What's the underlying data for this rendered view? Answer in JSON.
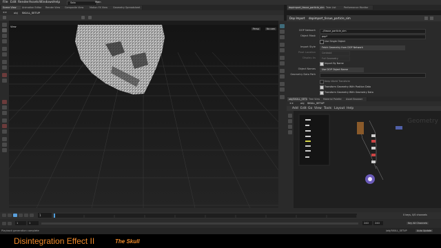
{
  "menu": [
    "File",
    "Edit",
    "Render",
    "Assets",
    "Windows",
    "Help"
  ],
  "menu_extras": {
    "desktop": "Solo",
    "main": "Main"
  },
  "left_tabs": [
    "Scene View",
    "Animation Editor",
    "Render View",
    "Composite View",
    "Motion FX View",
    "Geometry Spreadsheet"
  ],
  "right_tabs": [
    "dopimport_tissue_particle_sim",
    "Take List",
    "Performance Monitor"
  ],
  "viewport": {
    "path_obj": "obj",
    "path_node": "SKULL_SETUP",
    "title": "View",
    "persp": "Persp",
    "cam": "No cam"
  },
  "params": {
    "node_type": "Dop Import",
    "node_name": "dopimport_tissue_particle_sim",
    "rows": [
      {
        "label": "DOP Network",
        "value": "../tissue_particle_sim",
        "kind": "field"
      },
      {
        "label": "Object Mask",
        "value": "pop*",
        "kind": "field"
      },
      {
        "label": "",
        "value": "Use Single Object",
        "kind": "check"
      },
      {
        "label": "Import Style",
        "value": "Fetch Geometry from DOP Network",
        "kind": "field"
      },
      {
        "label": "Pivot Location",
        "value": "Centroid",
        "kind": "dim"
      },
      {
        "label": "Display As",
        "value": "Full Geometry",
        "kind": "dim"
      },
      {
        "label": "",
        "value": "Import By Name",
        "kind": "check"
      },
      {
        "label": "Object Names",
        "value": "Use DOP Object Name",
        "kind": "field"
      },
      {
        "label": "Geometry Data Path",
        "value": "",
        "kind": "field"
      },
      {
        "label": "",
        "value": "Keep World Transform",
        "kind": "check"
      },
      {
        "label": "",
        "value": "Transform Geometry With Position Data",
        "kind": "check"
      },
      {
        "label": "",
        "value": "Transform Geometry With Geometry Data",
        "kind": "check"
      }
    ]
  },
  "network": {
    "tabs": [
      "obj/SKULL_SETUP",
      "Tree View",
      "Material Palette",
      "Asset Browser"
    ],
    "path_obj": "obj",
    "path_node": "SKULL_SETUP",
    "menus": [
      "Add",
      "Edit",
      "Go",
      "View",
      "Tools",
      "Layout",
      "Help"
    ],
    "context_label": "Geometry"
  },
  "timeline": {
    "frame": "1",
    "range_start": "1",
    "range_start2": "1",
    "range_end": "240",
    "range_end2": "240",
    "keys_label": "0 keys, 0/0 channels",
    "keys_btn": "Key All Channels",
    "auto_update": "Auto Update"
  },
  "status": {
    "text": "Playback generation complete",
    "path": "/obj/SKULL_SETUP"
  },
  "banner": {
    "title": "Disintegration Effect II",
    "subtitle": "The Skull",
    "title_color": "#f08a2b"
  }
}
